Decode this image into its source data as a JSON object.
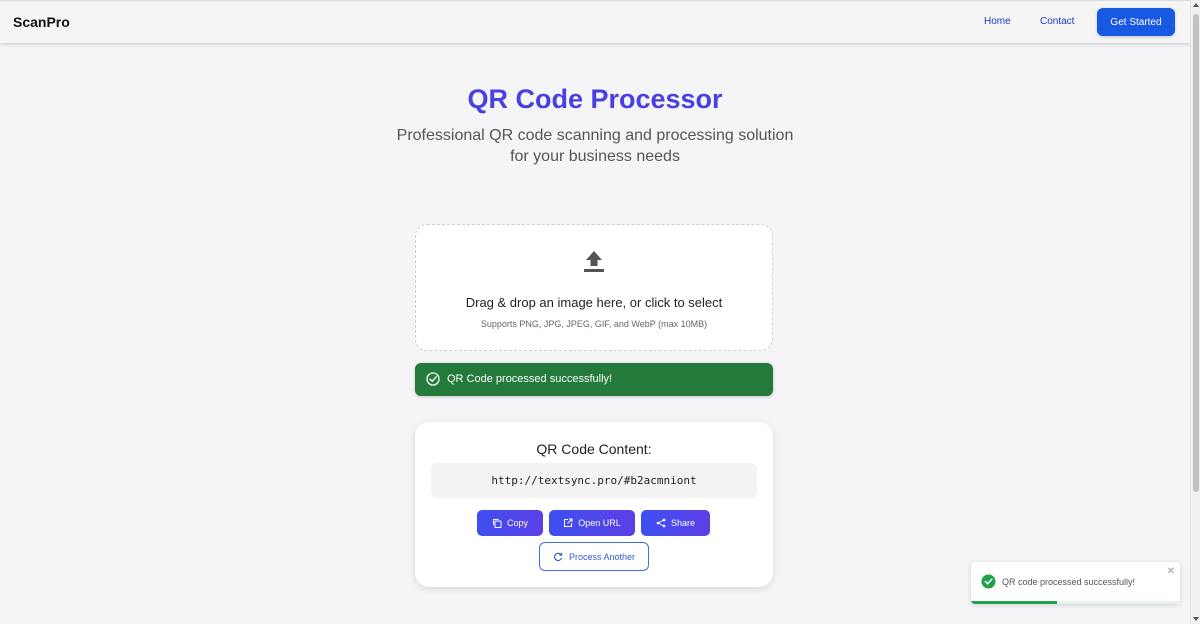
{
  "nav": {
    "brand": "ScanPro",
    "links": [
      "Home",
      "Contact"
    ],
    "cta_label": "Get Started"
  },
  "hero": {
    "title": "QR Code Processor",
    "subtitle": "Professional QR code scanning and processing solution for your business needs"
  },
  "dropzone": {
    "icon": "upload-icon",
    "prompt": "Drag & drop an image here, or click to select",
    "hint": "Supports PNG, JPG, JPEG, GIF, and WebP (max 10MB)"
  },
  "status": {
    "icon": "check-circle-icon",
    "message": "QR Code processed successfully!",
    "color": "#237a3a"
  },
  "result": {
    "title": "QR Code Content:",
    "value": "http://textsync.pro/#b2acmniont",
    "actions": {
      "copy": "Copy",
      "open_url": "Open URL",
      "share": "Share",
      "process_another": "Process Another"
    }
  },
  "toast": {
    "message": "QR code processed successfully!",
    "close": "✕",
    "progress": 0.41
  },
  "colors": {
    "accent": "#4a3fe0",
    "primary_button": "#1759e3",
    "success": "#237a3a"
  }
}
